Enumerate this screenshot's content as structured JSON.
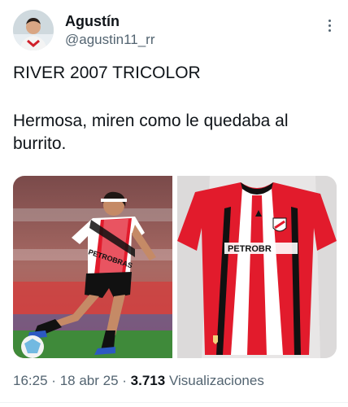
{
  "author": {
    "name": "Agustín",
    "handle": "@agustin11_rr",
    "avatar_icon": "avatar-icon"
  },
  "tweet": {
    "line1": "RIVER 2007 TRICOLOR",
    "line2": "Hermosa, miren como le quedaba al burrito."
  },
  "media": {
    "left_photo_icon": "player-photo",
    "right_photo_icon": "jersey-photo",
    "jersey_sponsor": "PETROBR",
    "left_jersey_sponsor": "PETROBRAS"
  },
  "meta": {
    "time": "16:25",
    "date": "18 abr 25",
    "views": "3.713",
    "views_label": "Visualizaciones",
    "separator": "·"
  },
  "colors": {
    "text_primary": "#0f1419",
    "text_secondary": "#536471",
    "jersey_red": "#e21b2c"
  }
}
